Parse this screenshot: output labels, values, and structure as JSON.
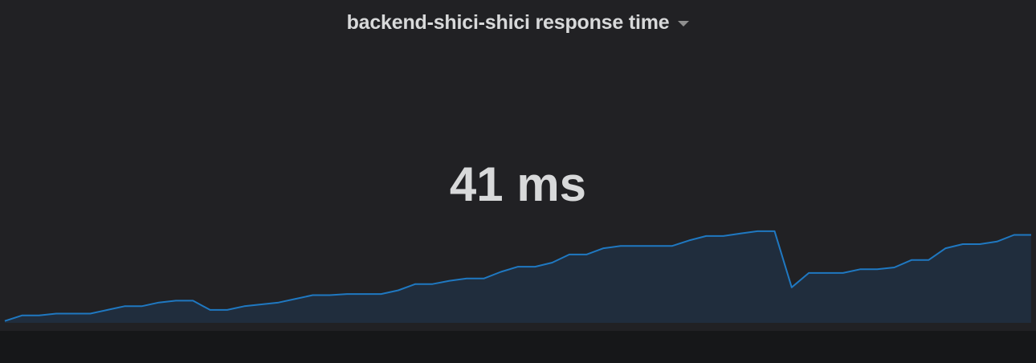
{
  "panel": {
    "title": "backend-shici-shici response time",
    "value": "41",
    "unit": "ms",
    "value_display": "41 ms",
    "menu_icon": "caret-down-icon"
  },
  "colors": {
    "panel_bg": "#212124",
    "page_bg": "#161719",
    "text": "#d8d9da",
    "line": "#1f78c1",
    "fill": "#202d3d"
  },
  "chart_data": {
    "type": "area",
    "values": [
      0.5,
      2,
      2,
      2.5,
      2.5,
      2.5,
      3.5,
      4.5,
      4.5,
      5.5,
      6,
      6,
      3.5,
      3.5,
      4.5,
      5,
      5.5,
      6.5,
      7.5,
      7.5,
      7.8,
      7.8,
      7.8,
      8.8,
      10.5,
      10.5,
      11.4,
      12,
      12,
      13.8,
      15.2,
      15.2,
      16.3,
      18.5,
      18.5,
      20.2,
      20.8,
      20.8,
      20.8,
      20.8,
      22.3,
      23.5,
      23.5,
      24.2,
      24.8,
      24.8,
      9.6,
      13.5,
      13.5,
      13.5,
      14.5,
      14.5,
      15,
      17,
      17,
      20.2,
      21.3,
      21.3,
      22,
      23.8,
      23.8
    ],
    "ylim": [
      0,
      50
    ]
  }
}
